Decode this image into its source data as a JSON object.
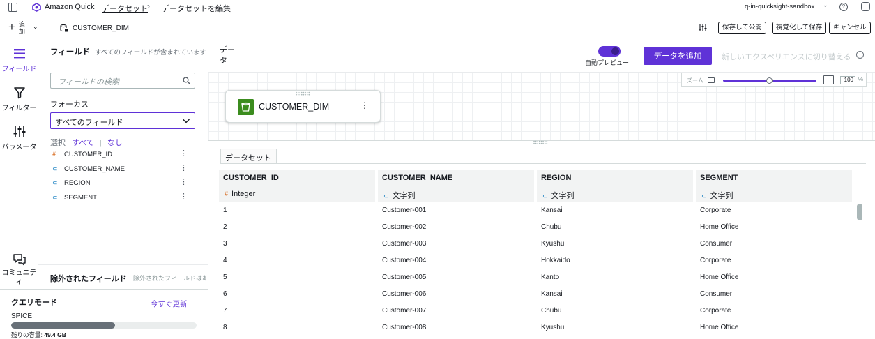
{
  "topbar": {
    "app_name": "Amazon Quick",
    "breadcrumb_datasets": "データセット",
    "breadcrumb_current": "データセットを編集",
    "account": "q-in-quicksight-sandbox"
  },
  "toolbar": {
    "add_label": "追加",
    "dataset_name": "CUSTOMER_DIM",
    "save_publish": "保存して公開",
    "save_visualize": "視覚化して保存",
    "cancel": "キャンセル"
  },
  "rail": {
    "fields": "フィールド",
    "filters": "フィルター",
    "parameters": "パラメータ",
    "community": "コミュニティ"
  },
  "field_panel": {
    "title": "フィールド",
    "subtitle": "すべてのフィールドが含まれています",
    "search_placeholder": "フィールドの検索",
    "focus_label": "フォーカス",
    "focus_value": "すべてのフィールド",
    "select_label": "選択",
    "select_all": "すべて",
    "select_none": "なし",
    "fields": [
      {
        "name": "CUSTOMER_ID",
        "type": "#"
      },
      {
        "name": "CUSTOMER_NAME",
        "type": "string"
      },
      {
        "name": "REGION",
        "type": "string"
      },
      {
        "name": "SEGMENT",
        "type": "string"
      }
    ],
    "excluded_title": "除外されたフィールド",
    "excluded_sub": "除外されたフィールドはありません"
  },
  "query_mode": {
    "title": "クエリモード",
    "refresh_now": "今すぐ更新",
    "spice": "SPICE",
    "capacity_label": "残りの容量: ",
    "capacity_value": "49.4 GB",
    "usage_fraction": 0.56
  },
  "data_header": {
    "title": "データ",
    "auto_preview": "自動プレビュー",
    "add_data": "データを追加",
    "new_experience": "新しいエクスペリエンスに切り替える"
  },
  "zoom": {
    "label": "ズーム",
    "value": "100",
    "unit": "%",
    "level_fraction": 0.5
  },
  "canvas": {
    "node_name": "CUSTOMER_DIM"
  },
  "table": {
    "tab": "データセット",
    "columns": [
      "CUSTOMER_ID",
      "CUSTOMER_NAME",
      "REGION",
      "SEGMENT"
    ],
    "types": [
      {
        "tag": "#",
        "label": "Integer"
      },
      {
        "tag": "string",
        "label": "文字列"
      },
      {
        "tag": "string",
        "label": "文字列"
      },
      {
        "tag": "string",
        "label": "文字列"
      }
    ],
    "rows": [
      [
        "1",
        "Customer-001",
        "Kansai",
        "Corporate"
      ],
      [
        "2",
        "Customer-002",
        "Chubu",
        "Home Office"
      ],
      [
        "3",
        "Customer-003",
        "Kyushu",
        "Consumer"
      ],
      [
        "4",
        "Customer-004",
        "Hokkaido",
        "Corporate"
      ],
      [
        "5",
        "Customer-005",
        "Kanto",
        "Home Office"
      ],
      [
        "6",
        "Customer-006",
        "Kansai",
        "Consumer"
      ],
      [
        "7",
        "Customer-007",
        "Chubu",
        "Corporate"
      ],
      [
        "8",
        "Customer-008",
        "Kyushu",
        "Home Office"
      ]
    ]
  },
  "colors": {
    "accent": "#5f32d7",
    "integer_tag": "#d45b07",
    "string_tag": "#0073bb"
  }
}
